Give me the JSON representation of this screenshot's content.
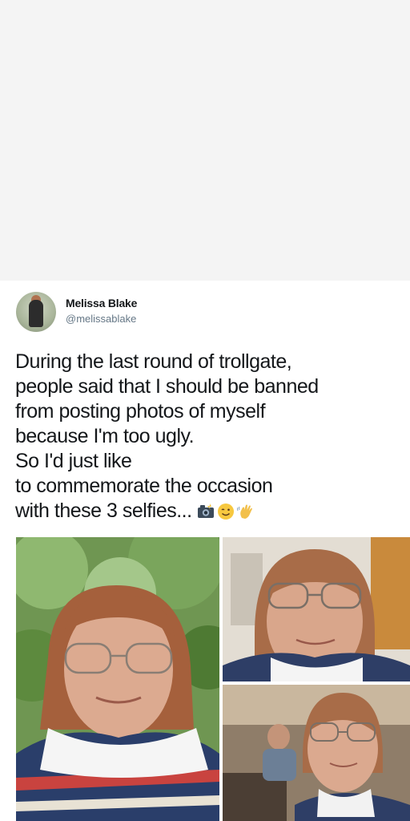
{
  "tweet": {
    "author_name": "Melissa Blake",
    "author_handle": "@melissablake",
    "text_lines": [
      "During the last round of trollgate,",
      "people said that I should be banned",
      "from posting photos of myself",
      "because I'm too ugly.",
      "So I'd just like",
      "to commemorate the occasion",
      "with these 3 selfies..."
    ],
    "emojis": [
      "camera-with-flash-icon",
      "winking-face-icon",
      "waving-hand-icon"
    ],
    "photo_count": 3
  }
}
